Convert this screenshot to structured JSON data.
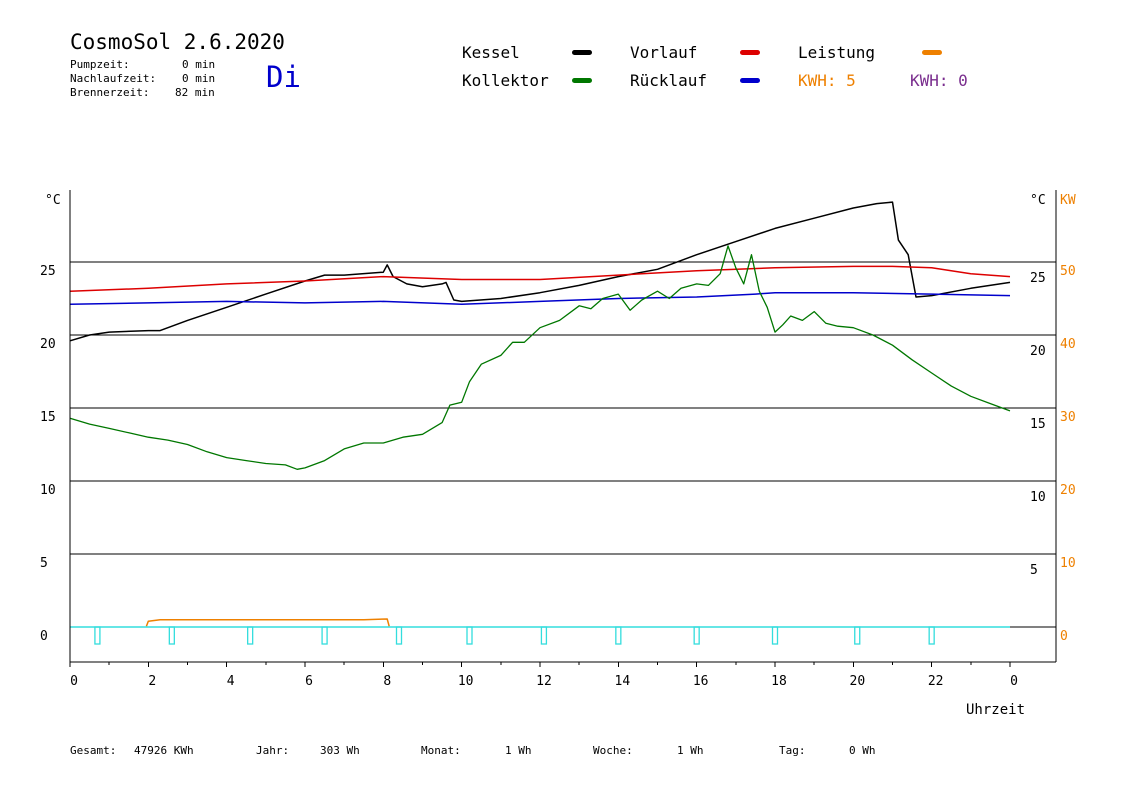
{
  "header": {
    "title": "CosmoSol 2.6.2020",
    "day": "Di",
    "stats": [
      {
        "label": "Pumpzeit:",
        "value": "0 min"
      },
      {
        "label": "Nachlaufzeit:",
        "value": "0 min"
      },
      {
        "label": "Brennerzeit:",
        "value": "82 min"
      }
    ]
  },
  "legend": {
    "kessel": "Kessel",
    "kollektor": "Kollektor",
    "vorlauf": "Vorlauf",
    "ruecklauf": "Rücklauf",
    "leistung": "Leistung",
    "kwh1": "KWH: 5",
    "kwh2": "KWH: 0"
  },
  "colors": {
    "kessel": "#000000",
    "kollektor": "#007700",
    "vorlauf": "#dd0000",
    "ruecklauf": "#0000cc",
    "leistung": "#ee8000",
    "kwh2": "#7a2e8e",
    "pump": "#33dddd"
  },
  "footer": {
    "gesamt_label": "Gesamt:",
    "gesamt_value": "47926 KWh",
    "jahr_label": "Jahr:",
    "jahr_value": "303 Wh",
    "monat_label": "Monat:",
    "monat_value": "1 Wh",
    "woche_label": "Woche:",
    "woche_value": "1 Wh",
    "tag_label": "Tag:",
    "tag_value": "0 Wh"
  },
  "chart_data": {
    "type": "line",
    "xlabel": "Uhrzeit",
    "ylabel_left": "°C",
    "ylabel_right": "°C",
    "ylabel_kw": "KW",
    "xlim": [
      0,
      24
    ],
    "ylim": [
      0,
      25
    ],
    "x_ticks": [
      0,
      2,
      4,
      6,
      8,
      10,
      12,
      14,
      16,
      18,
      20,
      22,
      24
    ],
    "x_tick_labels": [
      "0",
      "2",
      "4",
      "6",
      "8",
      "10",
      "12",
      "14",
      "16",
      "18",
      "20",
      "22",
      "0"
    ],
    "y_ticks": [
      0,
      5,
      10,
      15,
      20,
      25
    ],
    "y_tick_labels_left": [
      "0",
      "5",
      "10",
      "15",
      "20",
      "25"
    ],
    "y_tick_labels_right": [
      "",
      "5",
      "10",
      "15",
      "20",
      "25"
    ],
    "kw_ticks": [
      0,
      10,
      20,
      30,
      40,
      50
    ],
    "kw_tick_labels": [
      "0",
      "10",
      "20",
      "30",
      "40",
      "50"
    ],
    "grid": true,
    "series": [
      {
        "name": "Kessel",
        "color": "#000000",
        "points": [
          [
            0,
            19.6
          ],
          [
            0.5,
            20.0
          ],
          [
            1,
            20.2
          ],
          [
            2,
            20.3
          ],
          [
            2.3,
            20.3
          ],
          [
            3,
            21.0
          ],
          [
            4,
            21.9
          ],
          [
            5,
            22.8
          ],
          [
            6,
            23.7
          ],
          [
            6.5,
            24.1
          ],
          [
            7,
            24.1
          ],
          [
            8,
            24.3
          ],
          [
            8.1,
            24.8
          ],
          [
            8.25,
            24.0
          ],
          [
            8.6,
            23.5
          ],
          [
            9,
            23.3
          ],
          [
            9.5,
            23.5
          ],
          [
            9.6,
            23.6
          ],
          [
            9.8,
            22.4
          ],
          [
            10,
            22.3
          ],
          [
            11,
            22.5
          ],
          [
            12,
            22.9
          ],
          [
            13,
            23.4
          ],
          [
            14,
            24.0
          ],
          [
            15,
            24.5
          ],
          [
            16,
            25.5
          ],
          [
            17,
            26.4
          ],
          [
            18,
            27.3
          ],
          [
            19,
            28.0
          ],
          [
            20,
            28.7
          ],
          [
            20.6,
            29.0
          ],
          [
            21,
            29.1
          ],
          [
            21.15,
            26.5
          ],
          [
            21.4,
            25.5
          ],
          [
            21.6,
            22.6
          ],
          [
            22,
            22.7
          ],
          [
            23,
            23.2
          ],
          [
            24,
            23.6
          ]
        ]
      },
      {
        "name": "Vorlauf",
        "color": "#dd0000",
        "points": [
          [
            0,
            23.0
          ],
          [
            2,
            23.2
          ],
          [
            4,
            23.5
          ],
          [
            6,
            23.7
          ],
          [
            8,
            24.0
          ],
          [
            10,
            23.8
          ],
          [
            12,
            23.8
          ],
          [
            14,
            24.1
          ],
          [
            16,
            24.4
          ],
          [
            18,
            24.6
          ],
          [
            20,
            24.7
          ],
          [
            21,
            24.7
          ],
          [
            22,
            24.6
          ],
          [
            23,
            24.2
          ],
          [
            24,
            24.0
          ]
        ]
      },
      {
        "name": "Rücklauf",
        "color": "#0000cc",
        "points": [
          [
            0,
            22.1
          ],
          [
            2,
            22.2
          ],
          [
            4,
            22.3
          ],
          [
            6,
            22.2
          ],
          [
            8,
            22.3
          ],
          [
            10,
            22.1
          ],
          [
            12,
            22.3
          ],
          [
            14,
            22.5
          ],
          [
            16,
            22.6
          ],
          [
            17.5,
            22.8
          ],
          [
            18,
            22.9
          ],
          [
            20,
            22.9
          ],
          [
            22,
            22.8
          ],
          [
            24,
            22.7
          ]
        ]
      },
      {
        "name": "Kollektor",
        "color": "#007700",
        "points": [
          [
            0,
            14.3
          ],
          [
            0.5,
            13.9
          ],
          [
            1,
            13.6
          ],
          [
            1.5,
            13.3
          ],
          [
            2,
            13.0
          ],
          [
            2.5,
            12.8
          ],
          [
            3,
            12.5
          ],
          [
            3.5,
            12.0
          ],
          [
            4,
            11.6
          ],
          [
            4.5,
            11.4
          ],
          [
            5,
            11.2
          ],
          [
            5.5,
            11.1
          ],
          [
            5.8,
            10.8
          ],
          [
            6,
            10.9
          ],
          [
            6.5,
            11.4
          ],
          [
            7,
            12.2
          ],
          [
            7.5,
            12.6
          ],
          [
            8,
            12.6
          ],
          [
            8.5,
            13.0
          ],
          [
            9,
            13.2
          ],
          [
            9.5,
            14.0
          ],
          [
            9.7,
            15.2
          ],
          [
            10,
            15.4
          ],
          [
            10.2,
            16.8
          ],
          [
            10.5,
            18.0
          ],
          [
            11,
            18.6
          ],
          [
            11.3,
            19.5
          ],
          [
            11.6,
            19.5
          ],
          [
            12,
            20.5
          ],
          [
            12.5,
            21.0
          ],
          [
            13,
            22.0
          ],
          [
            13.3,
            21.8
          ],
          [
            13.6,
            22.5
          ],
          [
            14,
            22.8
          ],
          [
            14.3,
            21.7
          ],
          [
            14.6,
            22.4
          ],
          [
            15,
            23.0
          ],
          [
            15.3,
            22.5
          ],
          [
            15.6,
            23.2
          ],
          [
            16,
            23.5
          ],
          [
            16.3,
            23.4
          ],
          [
            16.6,
            24.2
          ],
          [
            16.8,
            26.1
          ],
          [
            17,
            24.6
          ],
          [
            17.2,
            23.5
          ],
          [
            17.4,
            25.5
          ],
          [
            17.6,
            23.0
          ],
          [
            17.8,
            21.9
          ],
          [
            18,
            20.2
          ],
          [
            18.2,
            20.7
          ],
          [
            18.4,
            21.3
          ],
          [
            18.7,
            21.0
          ],
          [
            19,
            21.6
          ],
          [
            19.3,
            20.8
          ],
          [
            19.6,
            20.6
          ],
          [
            20,
            20.5
          ],
          [
            20.5,
            20.0
          ],
          [
            21,
            19.3
          ],
          [
            21.5,
            18.3
          ],
          [
            22,
            17.4
          ],
          [
            22.5,
            16.5
          ],
          [
            23,
            15.8
          ],
          [
            23.5,
            15.3
          ],
          [
            24,
            14.8
          ]
        ]
      },
      {
        "name": "Leistung",
        "color": "#ee8000",
        "points": [
          [
            1.95,
            0.05
          ],
          [
            2.0,
            0.4
          ],
          [
            2.3,
            0.5
          ],
          [
            4,
            0.5
          ],
          [
            6,
            0.5
          ],
          [
            7.5,
            0.5
          ],
          [
            8.1,
            0.55
          ],
          [
            8.15,
            0.05
          ]
        ]
      }
    ],
    "pump_marks_hours": [
      0.7,
      2.6,
      4.6,
      6.5,
      8.4,
      10.2,
      12.1,
      14.0,
      16.0,
      18.0,
      20.1,
      22.0
    ]
  }
}
